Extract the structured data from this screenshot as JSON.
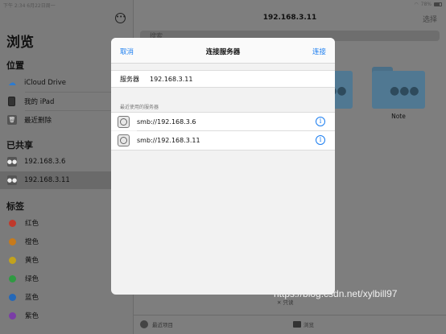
{
  "status_bar": {
    "time_date": "下午 2:34   6月22日周一",
    "battery": "78%"
  },
  "sidebar": {
    "more_icon": "ellipsis-icon",
    "title": "浏览",
    "locations_header": "位置",
    "locations": [
      {
        "label": "iCloud Drive",
        "icon": "cloud-icon"
      },
      {
        "label": "我的 iPad",
        "icon": "ipad-icon"
      },
      {
        "label": "最近删除",
        "icon": "trash-icon"
      }
    ],
    "shared_header": "已共享",
    "shared": [
      {
        "label": "192.168.3.6",
        "icon": "server-icon"
      },
      {
        "label": "192.168.3.11",
        "icon": "server-icon",
        "selected": true
      }
    ],
    "tags_header": "标签",
    "tags": [
      {
        "label": "红色",
        "color": "#c0392b"
      },
      {
        "label": "橙色",
        "color": "#c77a1b"
      },
      {
        "label": "黄色",
        "color": "#c2a21d"
      },
      {
        "label": "绿色",
        "color": "#2f9a42"
      },
      {
        "label": "蓝色",
        "color": "#2468b8"
      },
      {
        "label": "紫色",
        "color": "#7a3da6"
      }
    ]
  },
  "main": {
    "title": "192.168.3.11",
    "select_label": "选择",
    "search_placeholder": "搜索",
    "folders": [
      {
        "label": ""
      },
      {
        "label": "Note"
      }
    ],
    "readonly_label": "只读",
    "bottom": {
      "recent": "最近项目",
      "browse": "浏览"
    }
  },
  "modal": {
    "cancel": "取消",
    "title": "连接服务器",
    "connect": "连接",
    "server_label": "服务器",
    "server_value": "192.168.3.11",
    "recent_header": "最近使用的服务器",
    "recent_servers": [
      "smb://192.168.3.6",
      "smb://192.168.3.11"
    ]
  },
  "watermark": "https://blog.csdn.net/xylbill97"
}
